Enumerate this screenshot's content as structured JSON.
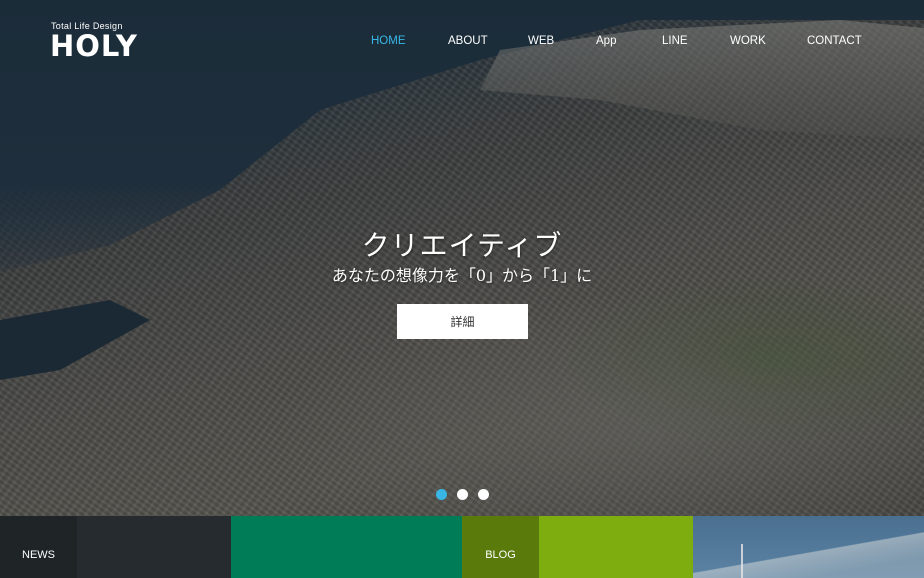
{
  "brand": {
    "tagline": "Total Life Design",
    "name": "HOLY"
  },
  "nav": {
    "items": [
      {
        "label": "HOME",
        "active": true
      },
      {
        "label": "ABOUT",
        "active": false
      },
      {
        "label": "WEB",
        "active": false
      },
      {
        "label": "App",
        "active": false
      },
      {
        "label": "LINE",
        "active": false
      },
      {
        "label": "WORK",
        "active": false
      },
      {
        "label": "CONTACT",
        "active": false
      }
    ]
  },
  "hero": {
    "headline": "クリエイティブ",
    "subline": "あなたの想像力を「0」から「1」に",
    "detail_button": "詳細",
    "slider": {
      "count": 3,
      "active_index": 0
    }
  },
  "tiles": [
    {
      "label": "NEWS",
      "color": "#1f2427"
    },
    {
      "label": "",
      "color": "#262b2f"
    },
    {
      "label": "",
      "color": "#007d57"
    },
    {
      "label": "BLOG",
      "color": "#5a7a0c"
    },
    {
      "label": "",
      "color": "#7dad0e"
    },
    {
      "label": "",
      "color": "image"
    }
  ],
  "colors": {
    "accent": "#38b7e6",
    "button_bg": "#ffffff"
  }
}
